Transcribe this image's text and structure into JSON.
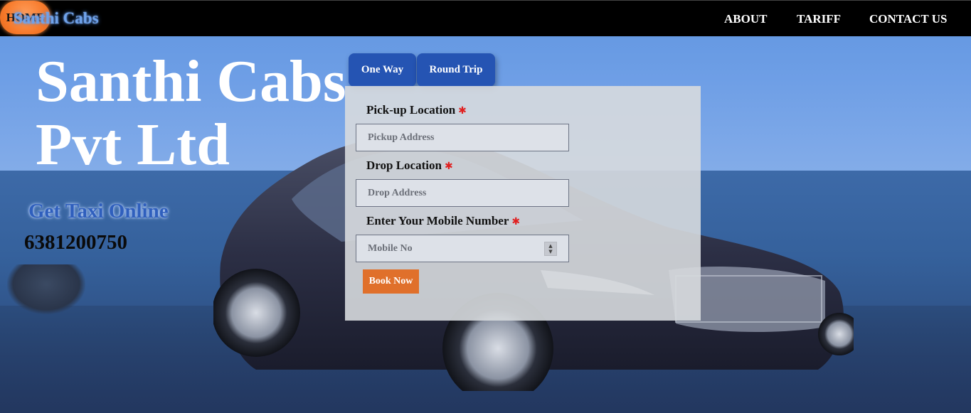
{
  "brand": {
    "name": "Santhi Cabs",
    "color": "#6fa2ea"
  },
  "nav": {
    "home": "HOME",
    "about": "ABOUT",
    "tariff": "TARIFF",
    "contact": "CONTACT US",
    "active_color": "#f77a2b"
  },
  "hero": {
    "title": "Santhi Cabs Pvt Ltd",
    "subtitle": "Get Taxi Online",
    "phone": "6381200750"
  },
  "tabs": {
    "one_way": "One Way",
    "round_trip": "Round Trip",
    "color": "#2554b3"
  },
  "form": {
    "pickup_label": "Pick-up Location",
    "pickup_placeholder": "Pickup Address",
    "drop_label": "Drop Location",
    "drop_placeholder": "Drop Address",
    "mobile_label": "Enter Your Mobile Number",
    "mobile_placeholder": "Mobile No",
    "required_mark": "✱",
    "book_button": "Book Now",
    "button_color": "#e0702b"
  },
  "icons": {
    "spinner_up": "▲",
    "spinner_down": "▼"
  }
}
